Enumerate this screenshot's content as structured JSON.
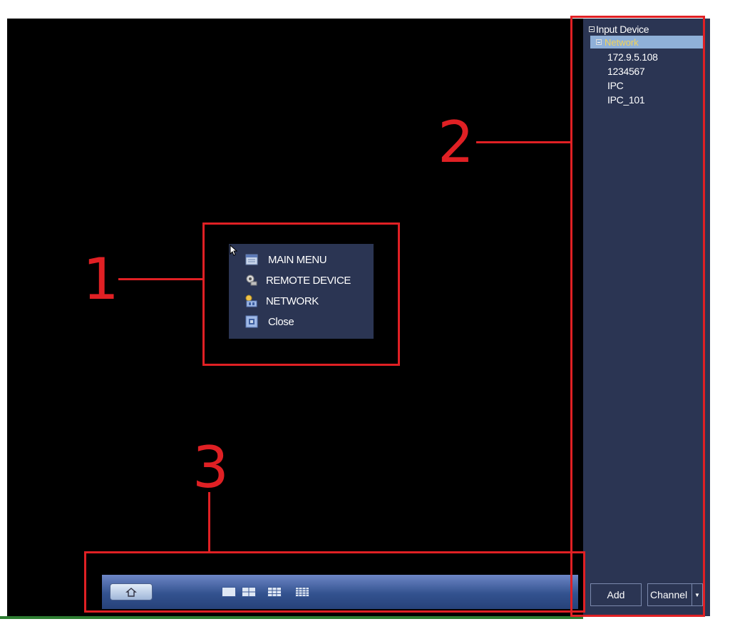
{
  "side_panel": {
    "tree_root": "Input Device",
    "tree_selected": "Network",
    "devices": [
      "172.9.5.108",
      "1234567",
      "IPC",
      "IPC_101"
    ],
    "add_button": "Add",
    "channel_button": "Channel"
  },
  "context_menu": {
    "items": [
      {
        "label": "MAIN MENU",
        "icon": "main-menu-icon"
      },
      {
        "label": "REMOTE DEVICE",
        "icon": "remote-device-icon"
      },
      {
        "label": "NETWORK",
        "icon": "network-icon"
      },
      {
        "label": "Close",
        "icon": "close-icon"
      }
    ]
  },
  "taskbar": {
    "home_icon": "home-icon",
    "split_icons": [
      "single-view-icon",
      "quad-view-icon",
      "nine-view-icon",
      "sixteen-view-icon"
    ]
  },
  "annotations": {
    "labels": [
      "1",
      "2",
      "3"
    ],
    "color": "#e02024"
  },
  "colors": {
    "panel": "#2b3553",
    "screen": "#000000",
    "selection": "#8fb0d8"
  }
}
